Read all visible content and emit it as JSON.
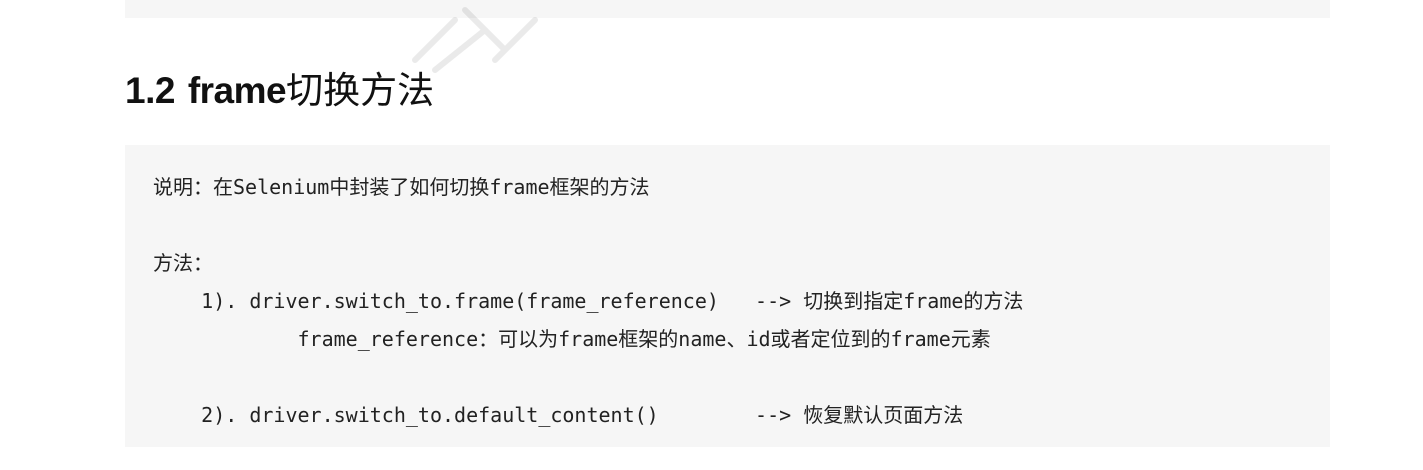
{
  "heading": {
    "number": "1.2",
    "keyword": "frame",
    "title_cn": "切换方法"
  },
  "code_block": {
    "lines": [
      "说明：在Selenium中封装了如何切换frame框架的方法",
      "方法：",
      "    1). driver.switch_to.frame(frame_reference)   --> 切换到指定frame的方法",
      "            frame_reference：可以为frame框架的name、id或者定位到的frame元素",
      "    2). driver.switch_to.default_content()        --> 恢复默认页面方法"
    ]
  }
}
